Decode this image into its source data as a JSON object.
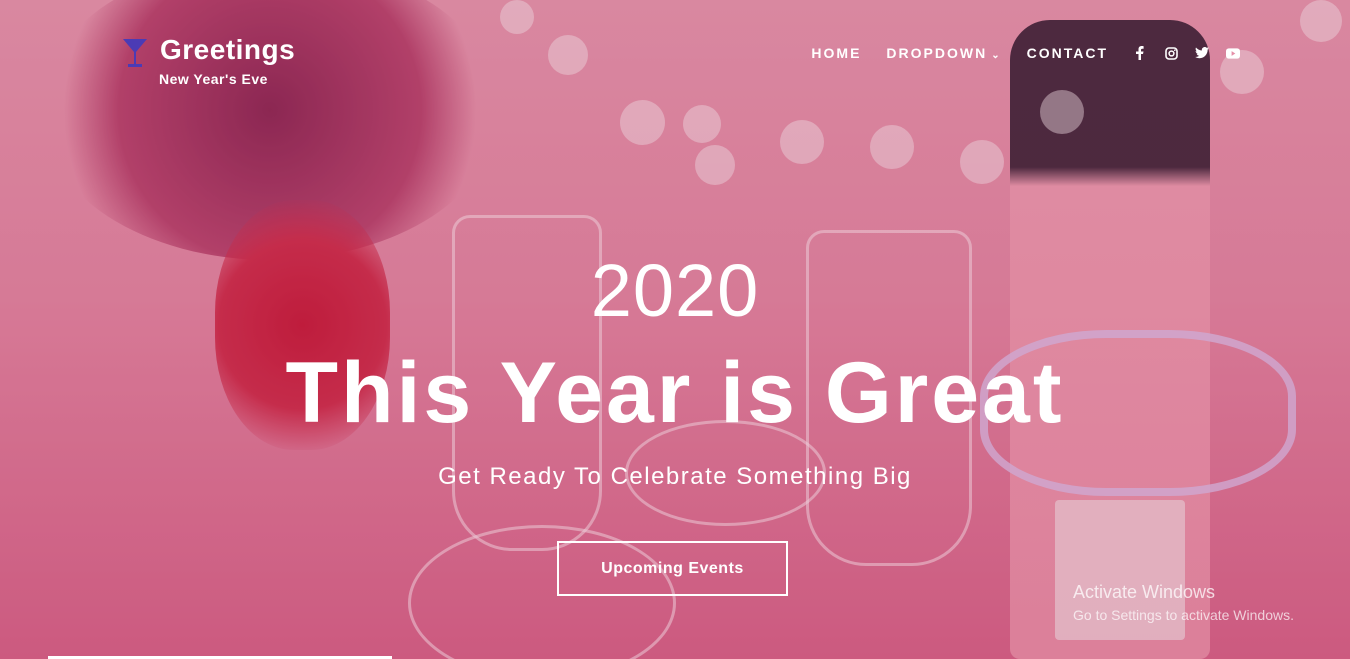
{
  "brand": {
    "name": "Greetings",
    "subtitle": "New Year's Eve",
    "icon": "cocktail-glass-icon",
    "icon_color": "#4b3bb5"
  },
  "nav": {
    "items": [
      {
        "label": "HOME"
      },
      {
        "label": "DROPDOWN",
        "has_dropdown": true
      },
      {
        "label": "CONTACT"
      }
    ],
    "social": [
      "facebook-icon",
      "instagram-icon",
      "twitter-icon",
      "youtube-icon"
    ]
  },
  "hero": {
    "year": "2020",
    "headline": "This Year is Great",
    "tagline": "Get Ready To Celebrate Something Big",
    "cta_label": "Upcoming Events"
  },
  "watermark": {
    "line1": "Activate Windows",
    "line2": "Go to Settings to activate Windows."
  },
  "colors": {
    "text": "#ffffff",
    "background": "#e58fa8"
  }
}
